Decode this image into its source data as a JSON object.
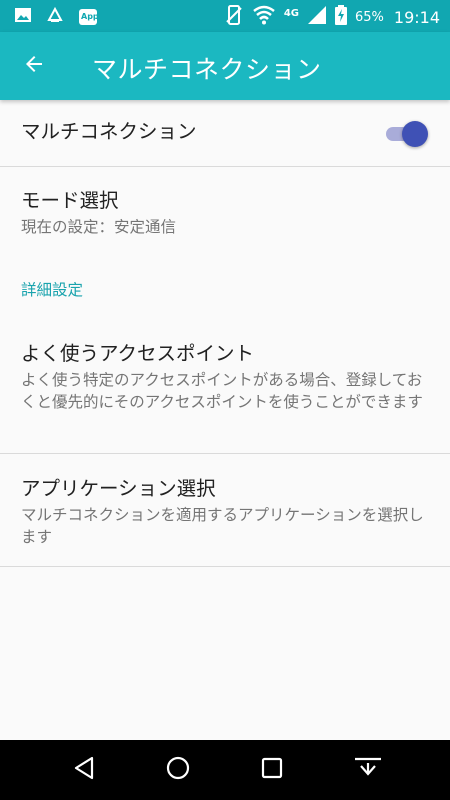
{
  "status_bar": {
    "left_icons": [
      "image-icon",
      "notification-icon",
      "app-badge-icon"
    ],
    "app_badge_text": "App",
    "network": "4G",
    "battery": "65%",
    "time": "19:14"
  },
  "appbar": {
    "title": "マルチコネクション",
    "back_icon": "arrow-left-icon"
  },
  "settings": {
    "multi_connection": {
      "label": "マルチコネクション",
      "enabled": true,
      "accent": "#3f51b5"
    },
    "mode": {
      "title": "モード選択",
      "summary": "現在の設定：安定通信"
    },
    "section_header": "詳細設定",
    "favorite_ap": {
      "title": "よく使うアクセスポイント",
      "summary": "よく使う特定のアクセスポイントがある場合、登録しておくと優先的にそのアクセスポイントを使うことができます"
    },
    "app_select": {
      "title": "アプリケーション選択",
      "summary": "マルチコネクションを適用するアプリケーションを選択します"
    }
  },
  "nav_bar": {
    "icons": [
      "back-triangle-icon",
      "home-circle-icon",
      "recents-square-icon",
      "hide-bar-icon"
    ]
  },
  "colors": {
    "status_bar": "#11a7b1",
    "app_bar": "#1bb8c1",
    "section_header": "#19a3ad"
  }
}
